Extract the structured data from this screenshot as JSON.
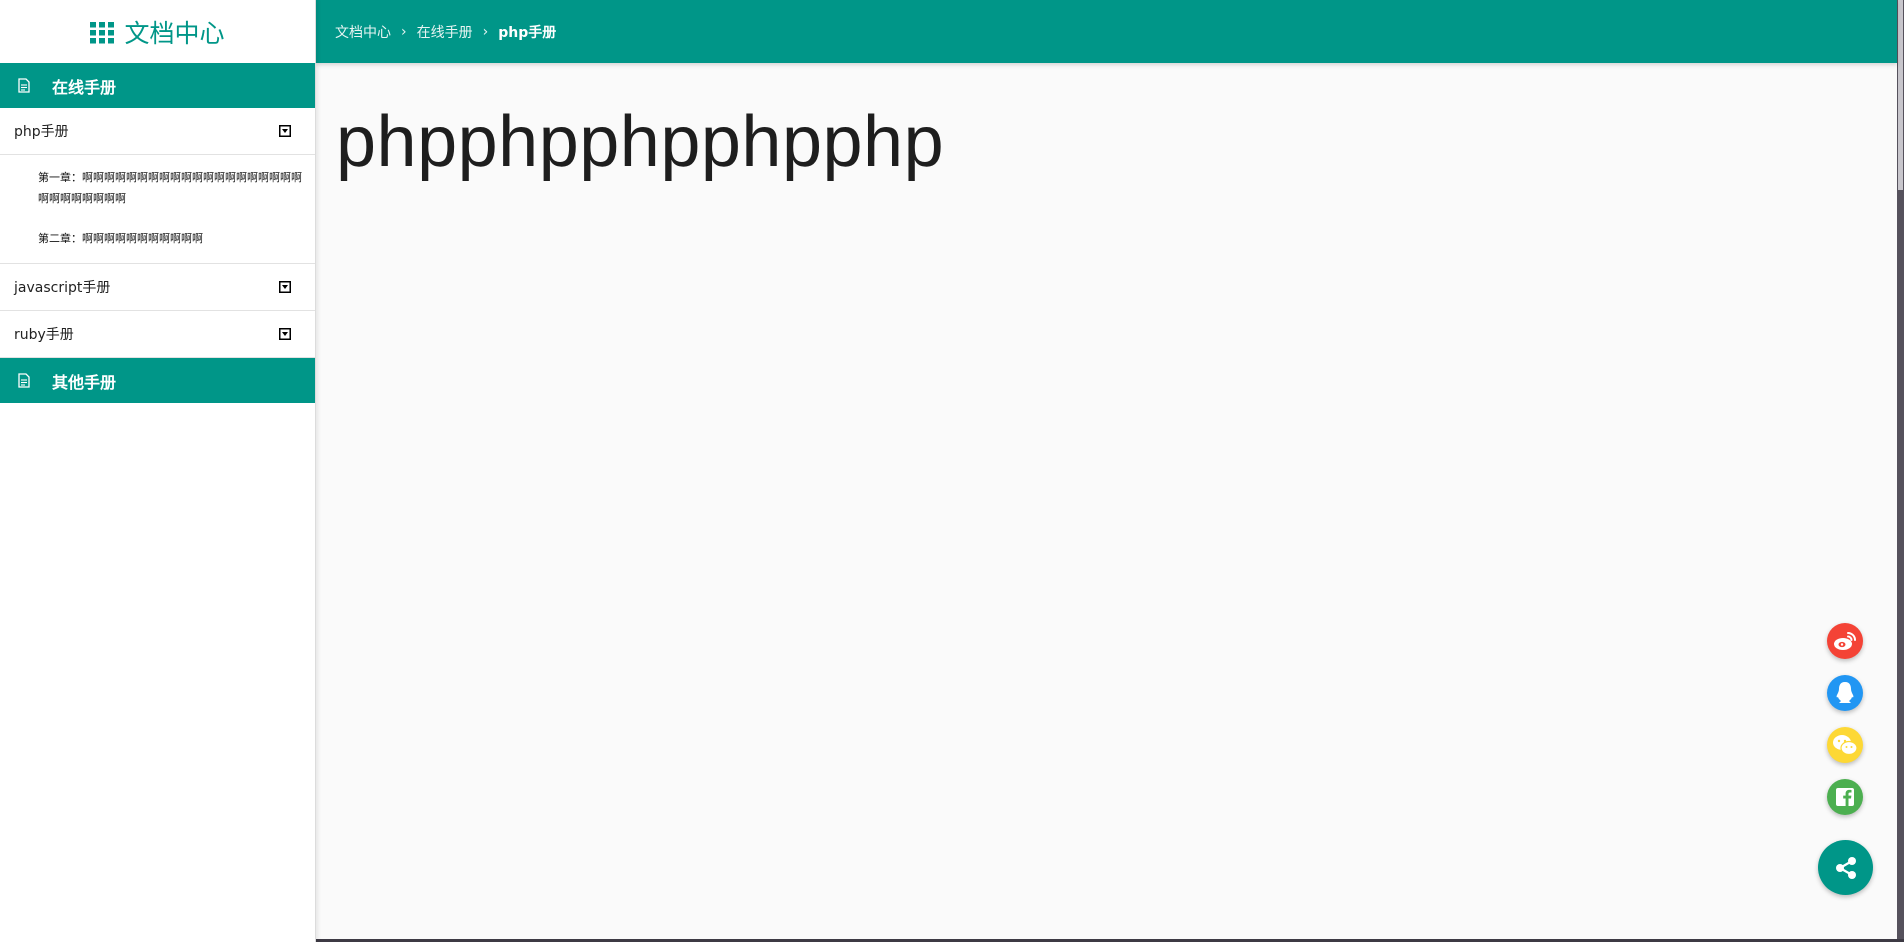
{
  "sidebar": {
    "brand": "文档中心",
    "sections": [
      {
        "label": "在线手册",
        "items": [
          {
            "label": "php手册",
            "subitems": [
              "第一章：啊啊啊啊啊啊啊啊啊啊啊啊啊啊啊啊啊啊啊啊啊啊啊啊啊啊啊啊",
              "第二章：啊啊啊啊啊啊啊啊啊啊啊"
            ]
          },
          {
            "label": "javascript手册"
          },
          {
            "label": "ruby手册"
          }
        ]
      },
      {
        "label": "其他手册"
      }
    ]
  },
  "breadcrumb": [
    "文档中心",
    "在线手册",
    "php手册"
  ],
  "main": {
    "title": "phpphpphpphpphp"
  },
  "share_buttons": [
    {
      "name": "weibo-icon",
      "color": "#f44336"
    },
    {
      "name": "qq-icon",
      "color": "#2196f3"
    },
    {
      "name": "wechat-icon",
      "color": "#fdd835"
    },
    {
      "name": "facebook-icon",
      "color": "#4caf50"
    },
    {
      "name": "share-icon",
      "color": "#009688"
    }
  ],
  "colors": {
    "accent": "#009688",
    "background": "#fafafa"
  }
}
